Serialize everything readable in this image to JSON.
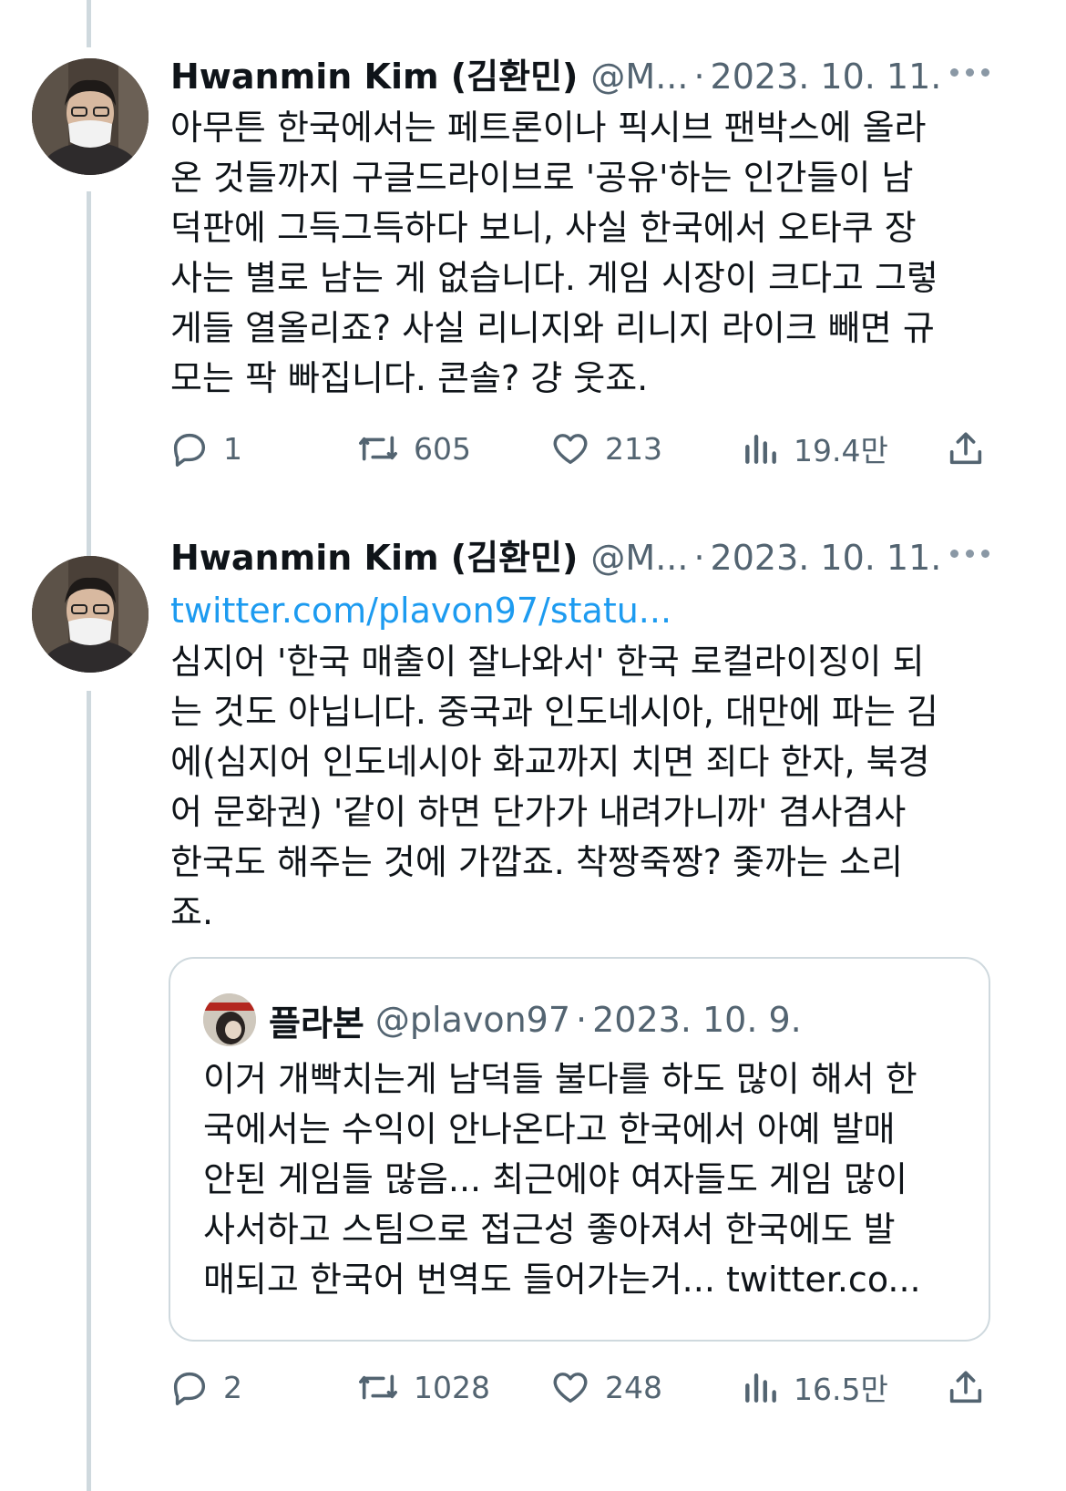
{
  "tweets": [
    {
      "author_name": "Hwanmin Kim (김환민)",
      "handle": "@M...",
      "separator": "·",
      "date": "2023. 10. 11.",
      "body_lines": [
        "아무튼 한국에서는 페트론이나 픽시브 팬박스에 올라",
        "온 것들까지 구글드라이브로 '공유'하는 인간들이 남",
        "덕판에 그득그득하다 보니, 사실 한국에서 오타쿠 장",
        "사는 별로 남는 게 없습니다. 게임 시장이 크다고 그렇",
        "게들 열올리죠? 사실 리니지와 리니지 라이크 빼면 규",
        "모는 팍 빠집니다. 콘솔? 걍 웃죠."
      ],
      "actions": {
        "replies": "1",
        "retweets": "605",
        "likes": "213",
        "views": "19.4만"
      }
    },
    {
      "author_name": "Hwanmin Kim (김환민)",
      "handle": "@M...",
      "separator": "·",
      "date": "2023. 10. 11.",
      "link": "twitter.com/plavon97/statu...",
      "body_lines": [
        "심지어 '한국 매출이 잘나와서' 한국 로컬라이징이 되",
        "는 것도 아닙니다. 중국과 인도네시아, 대만에 파는 김",
        "에(심지어 인도네시아 화교까지 치면 죄다 한자, 북경",
        "어 문화권) '같이 하면 단가가 내려가니까' 겸사겸사",
        "한국도 해주는 것에 가깝죠. 착짱죽짱? 좇까는 소리",
        "죠."
      ],
      "quote": {
        "author_name": "플라본",
        "handle": "@plavon97",
        "separator": "·",
        "date": "2023. 10. 9.",
        "body_lines": [
          "이거 개빡치는게 남덕들 불다를 하도 많이 해서 한",
          "국에서는 수익이 안나온다고 한국에서 아예 발매",
          "안된 게임들 많음... 최근에야 여자들도 게임 많이",
          "사서하고 스팀으로 접근성 좋아져서 한국에도 발"
        ],
        "last_line_text": "매되고 한국어 번역도 들어가는거... ",
        "last_line_link": "twitter.co..."
      },
      "actions": {
        "replies": "2",
        "retweets": "1028",
        "likes": "248",
        "views": "16.5만"
      }
    }
  ],
  "icons": {
    "reply": "reply-icon",
    "retweet": "retweet-icon",
    "like": "heart-icon",
    "views": "views-chart-icon",
    "share": "share-icon",
    "more": "more-icon"
  },
  "colors": {
    "text": "#0f1419",
    "secondary": "#536471",
    "link": "#1d9bf0",
    "thread_line": "#cfd9de",
    "border": "#cfd9de"
  }
}
